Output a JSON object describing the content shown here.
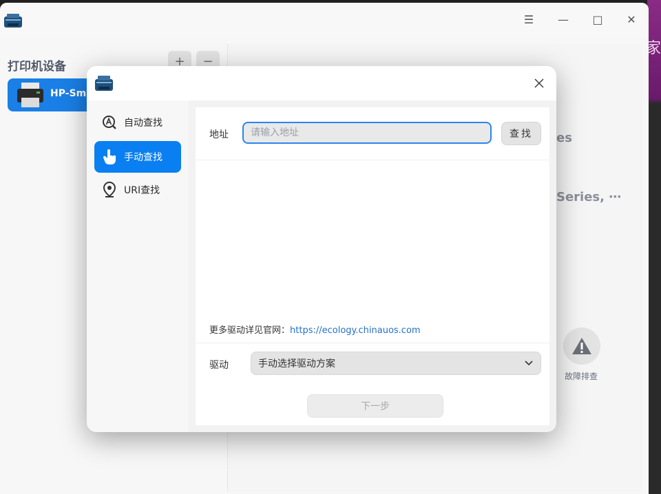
{
  "desktop": {
    "edge_text": "家居"
  },
  "main_window": {
    "controls": {
      "menu": "☰",
      "minimize": "—",
      "maximize": "□",
      "close": "✕"
    },
    "sidebar": {
      "title": "打印机设备",
      "add_label": "+",
      "remove_label": "−",
      "printers": [
        {
          "name": "HP-Sma"
        }
      ]
    },
    "background_text": {
      "partial_title": "es",
      "partial_series": "Series, ⋯"
    },
    "troubleshoot_label": "故障排查"
  },
  "dialog": {
    "nav": [
      {
        "label": "自动查找",
        "icon": "auto-search-icon",
        "active": false
      },
      {
        "label": "手动查找",
        "icon": "hand-pointer-icon",
        "active": true
      },
      {
        "label": "URI查找",
        "icon": "location-pin-icon",
        "active": false
      }
    ],
    "address_label": "地址",
    "address_placeholder": "请输入地址",
    "address_value": "",
    "search_label": "查找",
    "more_info_text": "更多驱动详见官网：",
    "more_info_link": "https://ecology.chinauos.com",
    "driver_label": "驱动",
    "driver_selected": "手动选择驱动方案",
    "next_label": "下一步"
  },
  "colors": {
    "accent": "#0a7ff2",
    "link": "#2171c8"
  }
}
